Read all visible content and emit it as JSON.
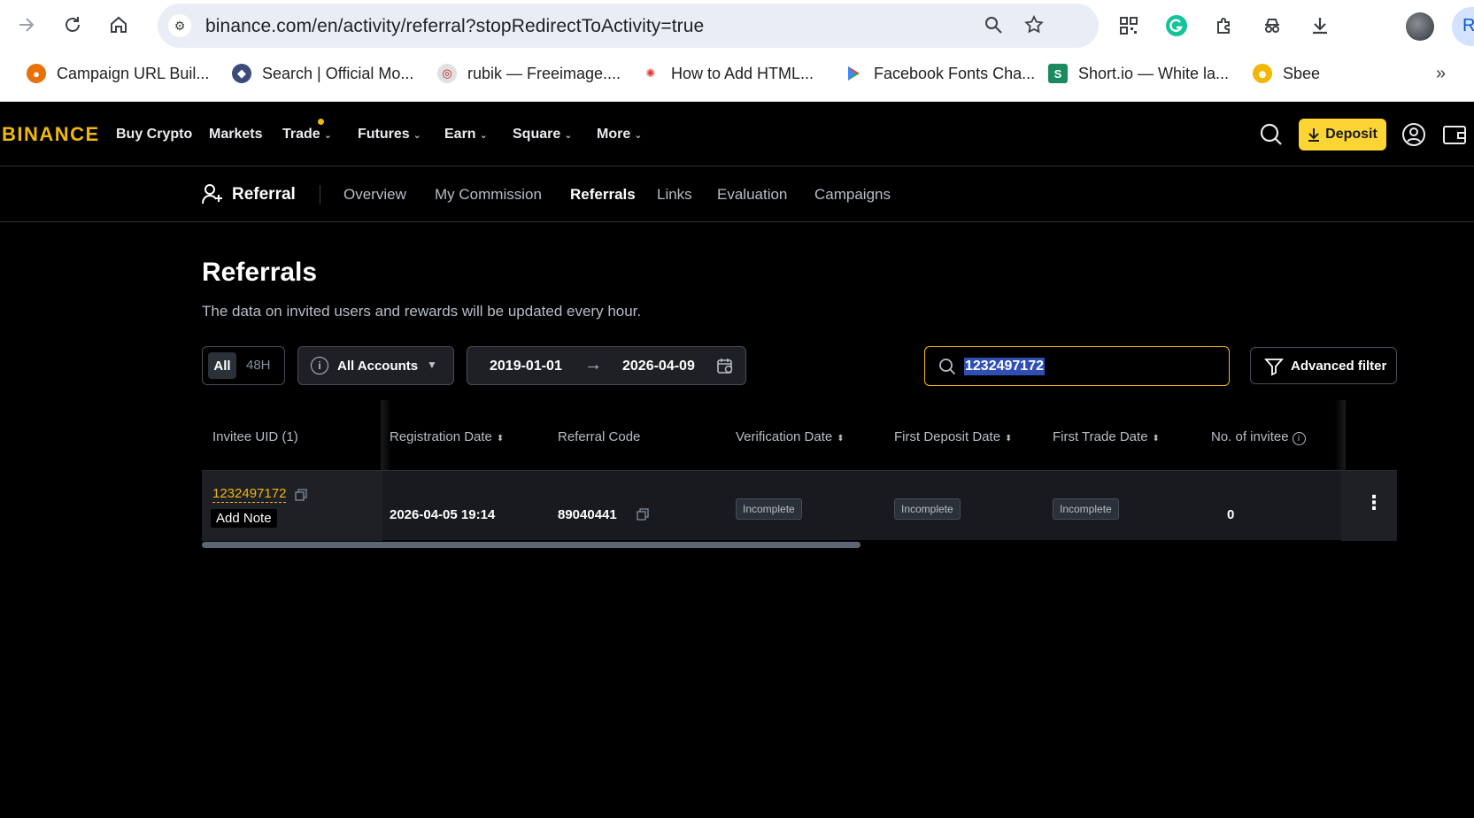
{
  "browser": {
    "url": "binance.com/en/activity/referral?stopRedirectToActivity=true",
    "profile_initial": "R",
    "bookmarks": [
      {
        "label": "Campaign URL Buil...",
        "icon": "campaign-favicon",
        "color": "#e8710a"
      },
      {
        "label": "Search | Official Mo...",
        "icon": "search-favicon",
        "color": "#3b4c7a"
      },
      {
        "label": "rubik — Freeimage....",
        "icon": "rubik-favicon",
        "color": "#c9c9c9"
      },
      {
        "label": "How to Add HTML...",
        "icon": "html-favicon",
        "color": "#e53935"
      },
      {
        "label": "Facebook Fonts Cha...",
        "icon": "play-favicon",
        "color": "#34a853"
      },
      {
        "label": "Short.io — White la...",
        "icon": "shortio-favicon",
        "color": "#1a8a5f"
      },
      {
        "label": "Sbee",
        "icon": "sbee-favicon",
        "color": "#f2b705"
      }
    ]
  },
  "binance": {
    "logo": "BINANCE",
    "nav": [
      "Buy Crypto",
      "Markets",
      "Trade",
      "Futures",
      "Earn",
      "Square",
      "More"
    ],
    "deposit_label": "Deposit",
    "accent": "#f0b90b"
  },
  "subnav": {
    "title": "Referral",
    "tabs": [
      "Overview",
      "My Commission",
      "Referrals",
      "Links",
      "Evaluation",
      "Campaigns"
    ],
    "active_tab": "Referrals"
  },
  "main": {
    "title": "Referrals",
    "subtitle": "The data on invited users and rewards will be updated every hour.",
    "filters": {
      "period_all": "All",
      "period_48h": "48H",
      "account": "All Accounts",
      "date_start": "2019-01-01",
      "date_end": "2026-04-09",
      "search_value": "1232497172",
      "advanced_filter": "Advanced filter"
    },
    "table": {
      "columns": [
        "Invitee UID (1)",
        "Registration Date",
        "Referral Code",
        "Verification Date",
        "First Deposit Date",
        "First Trade Date",
        "No. of invitee"
      ],
      "rows": [
        {
          "uid": "1232497172",
          "add_note": "Add Note",
          "registration_date": "2026-04-05 19:14",
          "referral_code": "89040441",
          "verification": "Incomplete",
          "first_deposit": "Incomplete",
          "first_trade": "Incomplete",
          "invitees": "0"
        }
      ]
    }
  }
}
